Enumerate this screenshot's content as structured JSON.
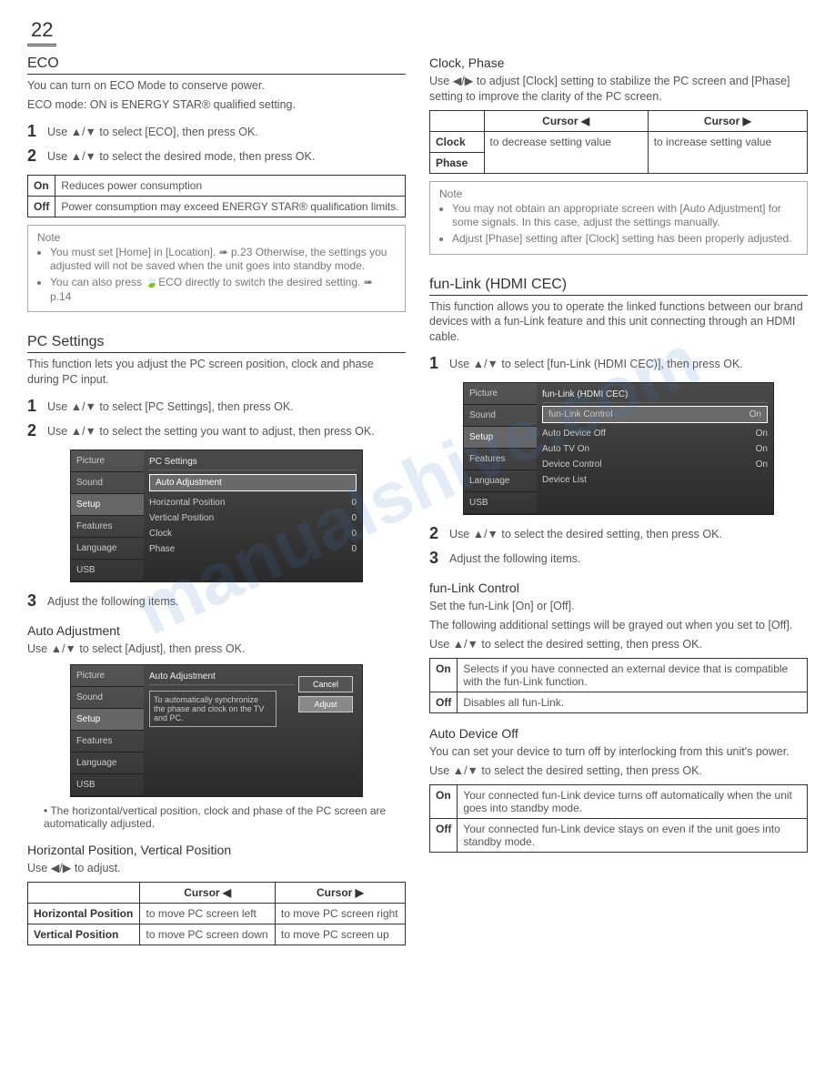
{
  "page_number": "22",
  "watermark": "manualshive.com",
  "left": {
    "eco": {
      "title": "ECO",
      "intro1": "You can turn on ECO Mode to conserve power.",
      "intro2": "ECO mode: ON is ENERGY STAR® qualified setting.",
      "steps": [
        "Use ▲/▼ to select [ECO], then press OK.",
        "Use ▲/▼ to select the desired mode, then press OK."
      ],
      "table": {
        "rows": [
          {
            "label": "On",
            "desc": "Reduces power consumption"
          },
          {
            "label": "Off",
            "desc": "Power consumption may exceed ENERGY STAR® qualification limits."
          }
        ]
      },
      "note_title": "Note",
      "notes": [
        "You must set [Home] in [Location]. ➠ p.23\nOtherwise, the settings you adjusted will not be saved when the unit goes into standby mode.",
        "You can also press 🍃ECO directly to switch the desired setting. ➠ p.14"
      ]
    },
    "pc": {
      "title": "PC Settings",
      "intro": "This function lets you adjust the PC screen position, clock and phase during PC input.",
      "steps": [
        "Use ▲/▼ to select [PC Settings], then press OK.",
        "Use ▲/▼ to select the setting you want to adjust, then press OK."
      ],
      "step3": "Adjust the following items.",
      "ss1": {
        "sidebar": [
          "Picture",
          "Sound",
          "Setup",
          "Features",
          "Language",
          "USB"
        ],
        "title": "PC Settings",
        "hl": "Auto Adjustment",
        "rows": [
          {
            "label": "Horizontal Position",
            "val": "0"
          },
          {
            "label": "Vertical Position",
            "val": "0"
          },
          {
            "label": "Clock",
            "val": "0"
          },
          {
            "label": "Phase",
            "val": "0"
          }
        ]
      },
      "auto": {
        "title": "Auto Adjustment",
        "intro": "Use ▲/▼ to select [Adjust], then press OK.",
        "ss": {
          "title": "Auto Adjustment",
          "text": "To automatically synchronize the phase and clock on the TV and PC.",
          "btn_cancel": "Cancel",
          "btn_adjust": "Adjust"
        },
        "bullet": "The horizontal/vertical position, clock and phase of the PC screen are automatically adjusted."
      },
      "hpos": {
        "title": "Horizontal Position, Vertical Position",
        "intro": "Use ◀/▶ to adjust.",
        "table": {
          "head_left": "Cursor ◀",
          "head_right": "Cursor ▶",
          "rows": [
            {
              "label": "Horizontal Position",
              "left": "to move PC screen left",
              "right": "to move PC screen right"
            },
            {
              "label": "Vertical Position",
              "left": "to move PC screen down",
              "right": "to move PC screen up"
            }
          ]
        }
      }
    }
  },
  "right": {
    "clockphase": {
      "title": "Clock, Phase",
      "intro": "Use ◀/▶ to adjust [Clock] setting to stabilize the PC screen and [Phase] setting to improve the clarity of the PC screen.",
      "table": {
        "head_left": "Cursor ◀",
        "head_right": "Cursor ▶",
        "rows": [
          {
            "label": "Clock",
            "left": "to decrease setting value",
            "right": "to increase setting value"
          },
          {
            "label": "Phase",
            "left": "",
            "right": ""
          }
        ]
      },
      "note_title": "Note",
      "notes": [
        "You may not obtain an appropriate screen with [Auto Adjustment] for some signals. In this case, adjust the settings manually.",
        "Adjust [Phase] setting after [Clock] setting has been properly adjusted."
      ]
    },
    "funlink": {
      "title": "fun-Link (HDMI CEC)",
      "intro": "This function allows you to operate the linked functions between our brand devices with a fun-Link feature and this unit connecting through an HDMI cable.",
      "step1": "Use ▲/▼ to select [fun-Link (HDMI CEC)], then press OK.",
      "ss": {
        "sidebar": [
          "Picture",
          "Sound",
          "Setup",
          "Features",
          "Language",
          "USB"
        ],
        "title": "fun-Link (HDMI CEC)",
        "rows": [
          {
            "label": "fun-Link Control",
            "val": "On",
            "hl": true
          },
          {
            "label": "Auto Device Off",
            "val": "On"
          },
          {
            "label": "Auto TV On",
            "val": "On"
          },
          {
            "label": "Device Control",
            "val": "On"
          },
          {
            "label": "Device List",
            "val": ""
          }
        ]
      },
      "step2": "Use ▲/▼ to select the desired setting, then press OK.",
      "step3": "Adjust the following items.",
      "control": {
        "title": "fun-Link Control",
        "l1": "Set the fun-Link [On] or [Off].",
        "l2": "The following additional settings will be grayed out when you set to [Off].",
        "l3": "Use ▲/▼ to select the desired setting, then press OK.",
        "table": {
          "rows": [
            {
              "label": "On",
              "desc": "Selects if you have connected an external device that is compatible with the fun-Link function."
            },
            {
              "label": "Off",
              "desc": "Disables all fun-Link."
            }
          ]
        }
      },
      "autooff": {
        "title": "Auto Device Off",
        "intro": "You can set your device to turn off by interlocking from this unit's power.",
        "l2": "Use ▲/▼ to select the desired setting, then press OK.",
        "table": {
          "rows": [
            {
              "label": "On",
              "desc": "Your connected fun-Link device turns off automatically when the unit goes into standby mode."
            },
            {
              "label": "Off",
              "desc": "Your connected fun-Link device stays on even if the unit goes into standby mode."
            }
          ]
        }
      }
    }
  }
}
